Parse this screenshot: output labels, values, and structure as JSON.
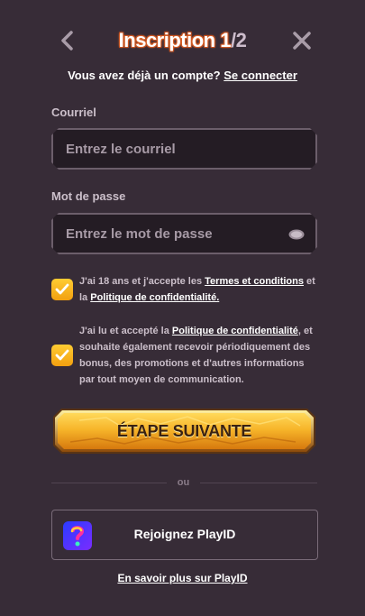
{
  "header": {
    "title_main": "Inscription 1",
    "title_separator": "/",
    "title_total": "2",
    "back_icon": "chevron-left-icon",
    "close_icon": "close-icon"
  },
  "login": {
    "prompt": "Vous avez déjà un compte?",
    "link": "Se connecter"
  },
  "email": {
    "label": "Courriel",
    "placeholder": "Entrez le courriel",
    "value": ""
  },
  "password": {
    "label": "Mot de passe",
    "placeholder": "Entrez le mot de passe",
    "value": "",
    "toggle_icon": "eye-icon"
  },
  "consent_terms": {
    "checked": true,
    "text_before": "J'ai 18 ans et j'accepte les ",
    "link_terms": "Termes et conditions",
    "text_middle": " et la ",
    "link_privacy": "Politique de confidentialité."
  },
  "consent_marketing": {
    "checked": true,
    "text_before": "J'ai lu et accepté la ",
    "link_privacy": "Politique de confidentialité",
    "text_after": ", et souhaite également recevoir périodiquement des bonus, des promotions et d'autres informations par tout moyen de communication."
  },
  "next_button": {
    "label": "ÉTAPE SUIVANTE"
  },
  "divider": {
    "text": "ou"
  },
  "playid": {
    "label": "Rejoignez PlayID",
    "logo_icon": "playid-logo-icon",
    "learn_more": "En savoir plus sur PlayID"
  },
  "colors": {
    "background": "#372c37",
    "input_bg": "#241c24",
    "checkbox": "#f7b520",
    "button_gold": "#f2a81a"
  }
}
